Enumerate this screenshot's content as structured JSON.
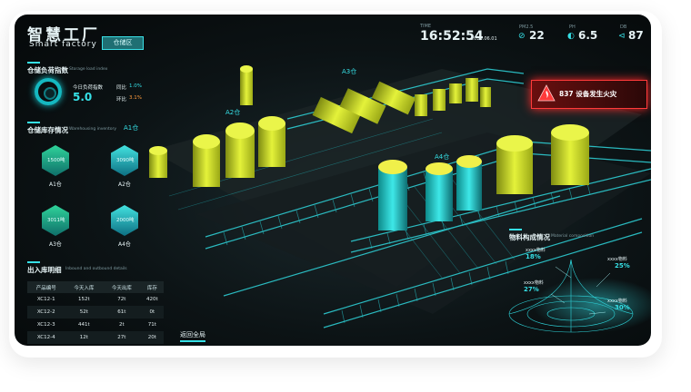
{
  "header": {
    "title_cn": "智慧工厂",
    "title_en": "Smart factory",
    "zone_tab": "仓储区"
  },
  "time": {
    "label": "TIME",
    "clock": "16:52:54",
    "date": "2020.06.01"
  },
  "metrics": [
    {
      "label": "PM2.5",
      "value": "22",
      "icon": "leaf-icon"
    },
    {
      "label": "PH",
      "value": "6.5",
      "icon": "drop-icon"
    },
    {
      "label": "DB",
      "value": "87",
      "icon": "sound-icon"
    }
  ],
  "load_index": {
    "title": "仓储负荷指数",
    "subtitle": "Storage load index",
    "today_label": "今日负荷指数",
    "today_value": "5.0",
    "yoy_label": "同比",
    "yoy_value": "1.0%",
    "mom_label": "环比",
    "mom_value": "3.1%"
  },
  "inventory": {
    "title": "仓储库存情况",
    "subtitle": "Warehousing inventory",
    "items": [
      {
        "value": "1500吨",
        "name": "A1仓"
      },
      {
        "value": "3090吨",
        "name": "A2仓"
      },
      {
        "value": "3011吨",
        "name": "A3仓"
      },
      {
        "value": "2000吨",
        "name": "A4仓"
      }
    ]
  },
  "details": {
    "title": "出入库明细",
    "subtitle": "Inbound and outbound details",
    "columns": [
      "产品编号",
      "今天入库",
      "今天出库",
      "库存"
    ],
    "rows": [
      [
        "XC12-1",
        "152t",
        "72t",
        "420t"
      ],
      [
        "XC12-2",
        "52t",
        "61t",
        "0t"
      ],
      [
        "XC12-3",
        "441t",
        "2t",
        "71t"
      ],
      [
        "XC12-4",
        "12t",
        "27t",
        "20t"
      ]
    ]
  },
  "warehouses": {
    "a1": "A1仓",
    "a2": "A2仓",
    "a3": "A3仓",
    "a4": "A4仓"
  },
  "alert": {
    "text": "837 设备发生火灾",
    "icon": "fire-icon"
  },
  "materials": {
    "title": "物料构成情况",
    "subtitle": "Material composition",
    "items": [
      {
        "name": "xxxx物料",
        "pct": "18%"
      },
      {
        "name": "xxxx物料",
        "pct": "25%"
      },
      {
        "name": "xxxx物料",
        "pct": "27%"
      },
      {
        "name": "xxxx物料",
        "pct": "30%"
      }
    ]
  },
  "nav": {
    "back_label": "返回全局"
  },
  "colors": {
    "accent": "#36e0e6",
    "tank": "#d6e62a",
    "alert": "#ff3a3a",
    "orange": "#ff9b3d"
  }
}
